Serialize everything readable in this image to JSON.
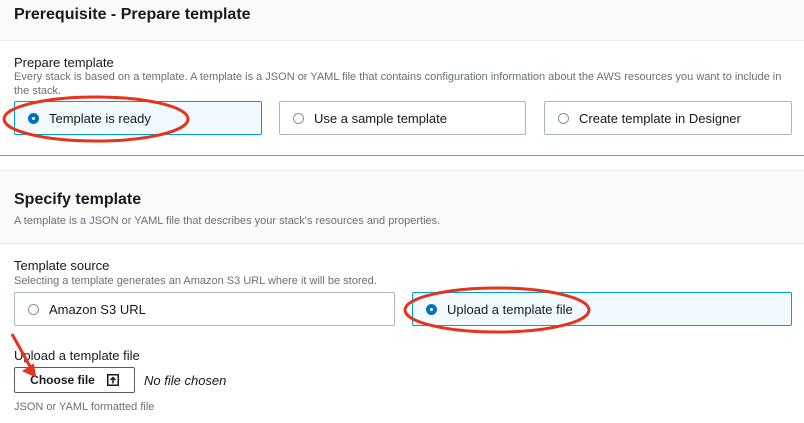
{
  "prereq": {
    "title": "Prerequisite - Prepare template",
    "label": "Prepare template",
    "description": "Every stack is based on a template. A template is a JSON or YAML file that contains configuration information about the AWS resources you want to include in the stack.",
    "options": [
      {
        "label": "Template is ready",
        "selected": true
      },
      {
        "label": "Use a sample template",
        "selected": false
      },
      {
        "label": "Create template in Designer",
        "selected": false
      }
    ]
  },
  "specify": {
    "title": "Specify template",
    "description": "A template is a JSON or YAML file that describes your stack's resources and properties.",
    "source_label": "Template source",
    "source_description": "Selecting a template generates an Amazon S3 URL where it will be stored.",
    "sources": [
      {
        "label": "Amazon S3 URL",
        "selected": false
      },
      {
        "label": "Upload a template file",
        "selected": true
      }
    ],
    "upload_label": "Upload a template file",
    "choose_file_label": "Choose file",
    "no_file_text": "No file chosen",
    "hint": "JSON or YAML formatted file"
  },
  "colors": {
    "annotation": "#e8321e",
    "radio_selected": "#0073bb",
    "selected_border": "#00a1c9"
  },
  "icons": {
    "upload": "upload-icon"
  }
}
